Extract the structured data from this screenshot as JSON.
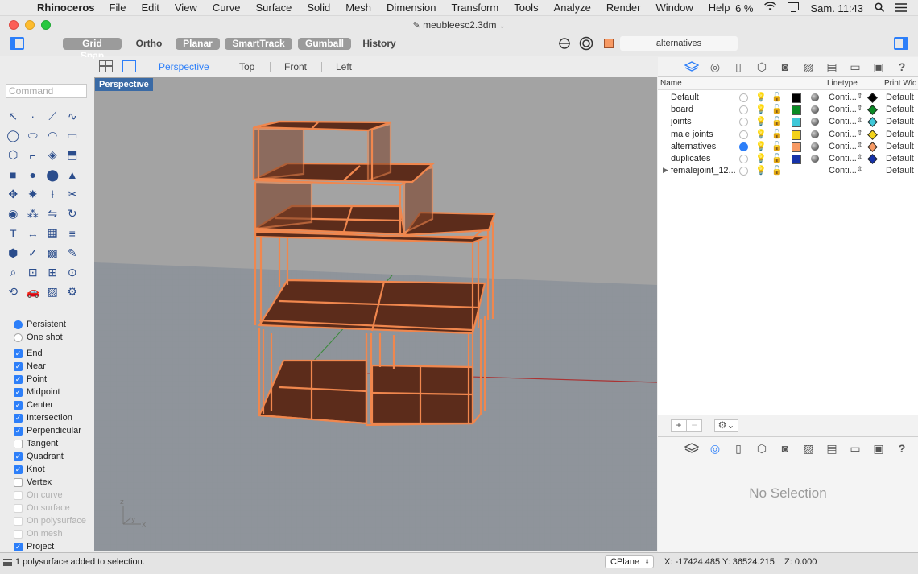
{
  "menubar": {
    "app_name": "Rhinoceros",
    "items": [
      "File",
      "Edit",
      "View",
      "Curve",
      "Surface",
      "Solid",
      "Mesh",
      "Dimension",
      "Transform",
      "Tools",
      "Analyze",
      "Render",
      "Window",
      "Help"
    ],
    "battery": "6 %",
    "clock": "Sam. 11:43"
  },
  "window": {
    "title": "meublees c2.3dm",
    "title_exact": "meubleesc2.3dm"
  },
  "toolbar": {
    "grid_snap": "Grid Snap",
    "ortho": "Ortho",
    "planar": "Planar",
    "smarttrack": "SmartTrack",
    "gumball": "Gumball",
    "history": "History",
    "current_layer": "alternatives",
    "current_layer_color": "#f79a64"
  },
  "command": {
    "placeholder": "Command"
  },
  "tools": [
    "cursor-arrow-icon",
    "point-icon",
    "polyline-icon",
    "curve-icon",
    "circle-icon",
    "ellipse-icon",
    "arc-icon",
    "rectangle-icon",
    "polygon-icon",
    "fillet-icon",
    "surface-icon",
    "extrude-icon",
    "box-icon",
    "sphere-icon",
    "cylinder-icon",
    "cone-icon",
    "move-icon",
    "explode-icon",
    "split-icon",
    "trim-icon",
    "fill-icon",
    "group-icon",
    "mirror-icon",
    "rotate-icon",
    "text-icon",
    "dimension-icon",
    "array-icon",
    "align-icon",
    "solid-tools-icon",
    "check-icon",
    "mesh-icon",
    "paint-icon",
    "zoom-icon",
    "zoom-window-icon",
    "zoom-extents-icon",
    "zoom-selected-icon",
    "rotate-view-icon",
    "render-car-icon",
    "hatch-icon",
    "properties-icon"
  ],
  "osnap": {
    "persistent": "Persistent",
    "one_shot": "One shot",
    "items": [
      {
        "label": "End",
        "checked": true
      },
      {
        "label": "Near",
        "checked": true
      },
      {
        "label": "Point",
        "checked": true
      },
      {
        "label": "Midpoint",
        "checked": true
      },
      {
        "label": "Center",
        "checked": true
      },
      {
        "label": "Intersection",
        "checked": true
      },
      {
        "label": "Perpendicular",
        "checked": true
      },
      {
        "label": "Tangent",
        "checked": false
      },
      {
        "label": "Quadrant",
        "checked": true
      },
      {
        "label": "Knot",
        "checked": true
      },
      {
        "label": "Vertex",
        "checked": false
      },
      {
        "label": "On curve",
        "checked": false,
        "disabled": true
      },
      {
        "label": "On surface",
        "checked": false,
        "disabled": true
      },
      {
        "label": "On polysurface",
        "checked": false,
        "disabled": true
      },
      {
        "label": "On mesh",
        "checked": false,
        "disabled": true
      },
      {
        "label": "Project",
        "checked": true
      }
    ]
  },
  "viewport_tabs": [
    "Perspective",
    "Top",
    "Front",
    "Left"
  ],
  "viewport": {
    "label": "Perspective",
    "axis_x": "x",
    "axis_y": "y",
    "axis_z": "z"
  },
  "layers": {
    "col_name": "Name",
    "col_linetype": "Linetype",
    "col_print": "Print Wid",
    "rows": [
      {
        "name": "Default",
        "color": "#000000",
        "linetype": "Conti...",
        "print_color": "#000000",
        "print_width": "Default",
        "current": false,
        "expandable": false
      },
      {
        "name": "board",
        "color": "#0a8a24",
        "linetype": "Conti...",
        "print_color": "#0a8a24",
        "print_width": "Default",
        "current": false,
        "expandable": false
      },
      {
        "name": "joints",
        "color": "#3fc8d8",
        "linetype": "Conti...",
        "print_color": "#3fc8d8",
        "print_width": "Default",
        "current": false,
        "expandable": false
      },
      {
        "name": "male joints",
        "color": "#f2d21a",
        "linetype": "Conti...",
        "print_color": "#f2d21a",
        "print_width": "Default",
        "current": false,
        "expandable": false
      },
      {
        "name": "alternatives",
        "color": "#f79a64",
        "linetype": "Conti...",
        "print_color": "#f79a64",
        "print_width": "Default",
        "current": true,
        "expandable": false
      },
      {
        "name": "duplicates",
        "color": "#1632a8",
        "linetype": "Conti...",
        "print_color": "#1632a8",
        "print_width": "Default",
        "current": false,
        "expandable": false
      },
      {
        "name": "femalejoint_12...",
        "color": "",
        "linetype": "Conti...",
        "print_color": "",
        "print_width": "Default",
        "current": false,
        "expandable": true
      }
    ]
  },
  "properties": {
    "empty_text": "No Selection"
  },
  "status": {
    "message": "1 polysurface added to selection.",
    "cplane": "CPlane",
    "coords": "X: -17424.485 Y: 36524.215",
    "z": "Z: 0.000"
  }
}
